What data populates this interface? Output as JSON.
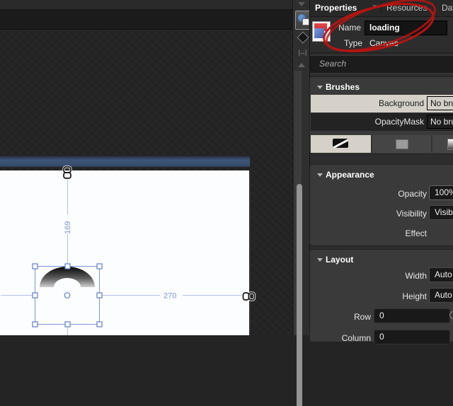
{
  "colors": {
    "panel_bg": "#2d2d2d",
    "group_bg": "#3a3a3a",
    "workspace_bg": "#242424",
    "selected_row": "#d5d1c9",
    "artboard_white": "#fcfdfe",
    "design_blue_bar": "#3a5070",
    "selection_blue": "#7b96d8",
    "dimension_blue": "#7d99d8",
    "annotation_red": "#c01310"
  },
  "artboard": {
    "dim_top": "169",
    "dim_right": "270"
  },
  "panel": {
    "tabs": [
      {
        "label": "Properties",
        "close_glyph": "×"
      },
      {
        "label": "Resources"
      },
      {
        "label": "Data"
      }
    ],
    "name_row": {
      "label": "Name",
      "value": "loading"
    },
    "type_row": {
      "label": "Type",
      "value": "Canvas"
    },
    "search": {
      "placeholder": "Search"
    },
    "sections": {
      "brushes": {
        "title": "Brushes",
        "rows": [
          {
            "label": "Background",
            "value": "No brush"
          },
          {
            "label": "OpacityMask",
            "value": "No brush"
          }
        ]
      },
      "appearance": {
        "title": "Appearance",
        "rows": [
          {
            "label": "Opacity",
            "value": "100%"
          },
          {
            "label": "Visibility",
            "value": "Visible"
          },
          {
            "label": "Effect",
            "value": ""
          }
        ]
      },
      "layout": {
        "title": "Layout",
        "rows": [
          {
            "label": "Width",
            "value": "Auto"
          },
          {
            "label": "Height",
            "value": "Auto"
          },
          {
            "label": "Row",
            "value": "0"
          },
          {
            "label": "Column",
            "value": "0"
          }
        ]
      }
    }
  }
}
